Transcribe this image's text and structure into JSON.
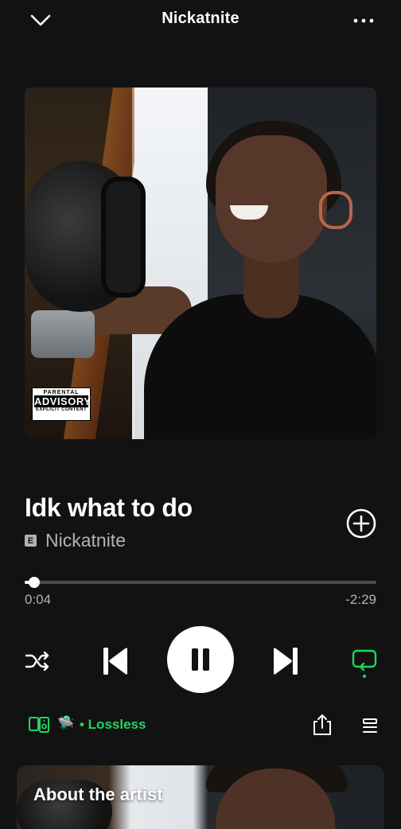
{
  "header": {
    "title": "Nickatnite",
    "collapse_icon": "chevron-down-icon",
    "more_icon": "more-horizontal-icon"
  },
  "album_art": {
    "advisory": {
      "line1": "PARENTAL",
      "line2": "ADVISORY",
      "line3": "EXPLICIT CONTENT"
    }
  },
  "track": {
    "title": "Idk what to do",
    "explicit_badge": "E",
    "artist": "Nickatnite",
    "add_icon": "add-circle-icon"
  },
  "progress": {
    "elapsed": "0:04",
    "remaining": "-2:29",
    "fraction": 0.027
  },
  "controls": {
    "shuffle_icon": "shuffle-icon",
    "previous_icon": "skip-previous-icon",
    "pause_icon": "pause-icon",
    "next_icon": "skip-next-icon",
    "repeat_icon": "repeat-icon"
  },
  "bottom": {
    "device_icon": "connect-device-icon",
    "ufo_emoji": "🛸",
    "quality_label": "• Lossless",
    "share_icon": "share-icon",
    "queue_icon": "queue-icon"
  },
  "about": {
    "title": "About the artist"
  },
  "colors": {
    "background": "#121212",
    "accent": "#1ed760",
    "secondary_text": "#b3b3b3"
  }
}
